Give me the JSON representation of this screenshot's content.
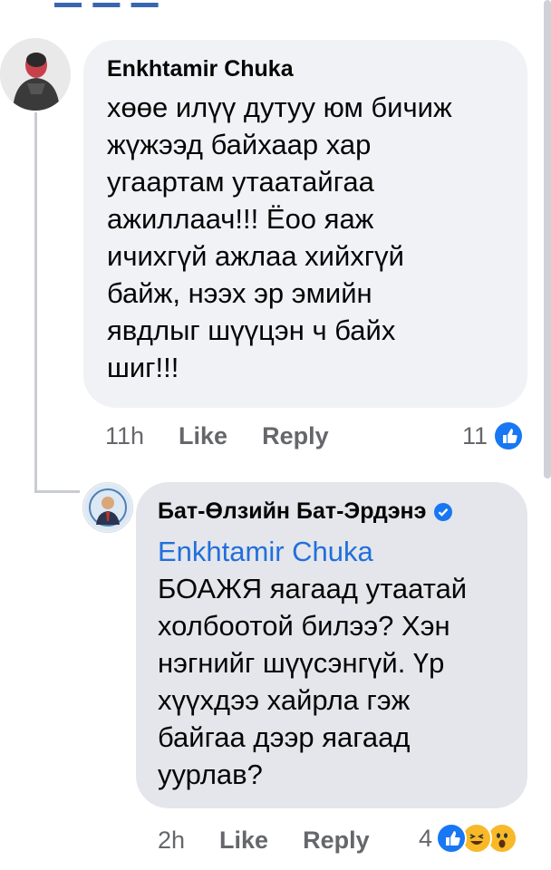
{
  "comment": {
    "author": "Enkhtamir Chuka",
    "lines": [
      "хөөе илүү дутуу юм бичиж",
      "жүжээд байхаар хар",
      "угаартам утаатайгаа",
      "ажиллаач!!! Ёоо яаж",
      "ичихгүй ажлаа хийхгүй",
      "байж, нээх эр эмийн",
      "явдлыг шүүцэн ч байх",
      "шиг!!!"
    ],
    "time": "11h",
    "like_label": "Like",
    "reply_label": "Reply",
    "reaction_count": "11"
  },
  "reply": {
    "author": "Бат-Өлзийн Бат-Эрдэнэ",
    "mention": "Enkhtamir Chuka",
    "lines": [
      "БОАЖЯ яагаад утаатай",
      "холбоотой билээ? Хэн",
      "нэгнийг шүүсэнгүй. Үр",
      "хүүхдээ хайрла гэж",
      "байгаа дээр яагаад",
      "уурлав?"
    ],
    "time": "2h",
    "like_label": "Like",
    "reply_label": "Reply",
    "reaction_count": "4",
    "reactions": [
      "like-icon",
      "haha-icon",
      "wow-icon"
    ]
  },
  "colors": {
    "bubble": "#f0f2f5",
    "link": "#216fdb",
    "muted": "#65676b",
    "like": "#1877f2",
    "verified": "#1877f2"
  }
}
